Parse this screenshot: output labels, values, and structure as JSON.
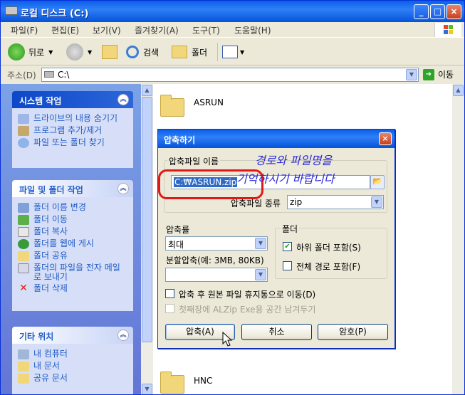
{
  "window": {
    "title": "로컬 디스크 (C:)",
    "minimize": "_",
    "maximize": "□",
    "close": "×"
  },
  "menu": [
    "파일(F)",
    "편집(E)",
    "보기(V)",
    "즐겨찾기(A)",
    "도구(T)",
    "도움말(H)"
  ],
  "toolbar": {
    "back": "뒤로",
    "search": "검색",
    "folders": "폴더"
  },
  "address": {
    "label": "주소(D)",
    "value": "C:\\",
    "go": "이동"
  },
  "left_panels": [
    {
      "title": "시스템 작업",
      "items": [
        "드라이브의 내용 숨기기",
        "프로그램 추가/제거",
        "파일 또는 폴더 찾기"
      ]
    },
    {
      "title": "파일 및 폴더 작업",
      "items": [
        "폴더 이름 변경",
        "폴더 이동",
        "폴더 복사",
        "폴더를 웹에 게시",
        "폴더 공유",
        "폴더의 파일을 전자 메일로 보내기",
        "폴더 삭제"
      ]
    },
    {
      "title": "기타 위치",
      "items": [
        "내 컴퓨터",
        "내 문서",
        "공유 문서"
      ]
    }
  ],
  "folders": [
    "ASRUN",
    "HNC"
  ],
  "dialog": {
    "title": "압축하기",
    "archive_group": "압축파일 이름",
    "archive_path": "C:₩ASRUN.zip",
    "archive_type_label": "압축파일 종류",
    "archive_type": "zip",
    "ratio_label": "압축률",
    "ratio_value": "최대",
    "split_label": "분할압축(예: 3MB, 80KB)",
    "split_value": "",
    "folder_group": "폴더",
    "include_sub": "하위 폴더 포함(S)",
    "include_sub_checked": true,
    "full_path": "전체 경로 포함(F)",
    "full_path_checked": false,
    "move_trash": "압축 후 원본 파일 휴지통으로 이동(D)",
    "alzip_space": "첫째장에 ALZip Exe용 공간 남겨두기",
    "btn_compress": "압축(A)",
    "btn_cancel": "취소",
    "btn_password": "암호(P)"
  },
  "annotation": {
    "line1": "경로와 파일명을",
    "line2": "기억하시기 바랍니다"
  }
}
